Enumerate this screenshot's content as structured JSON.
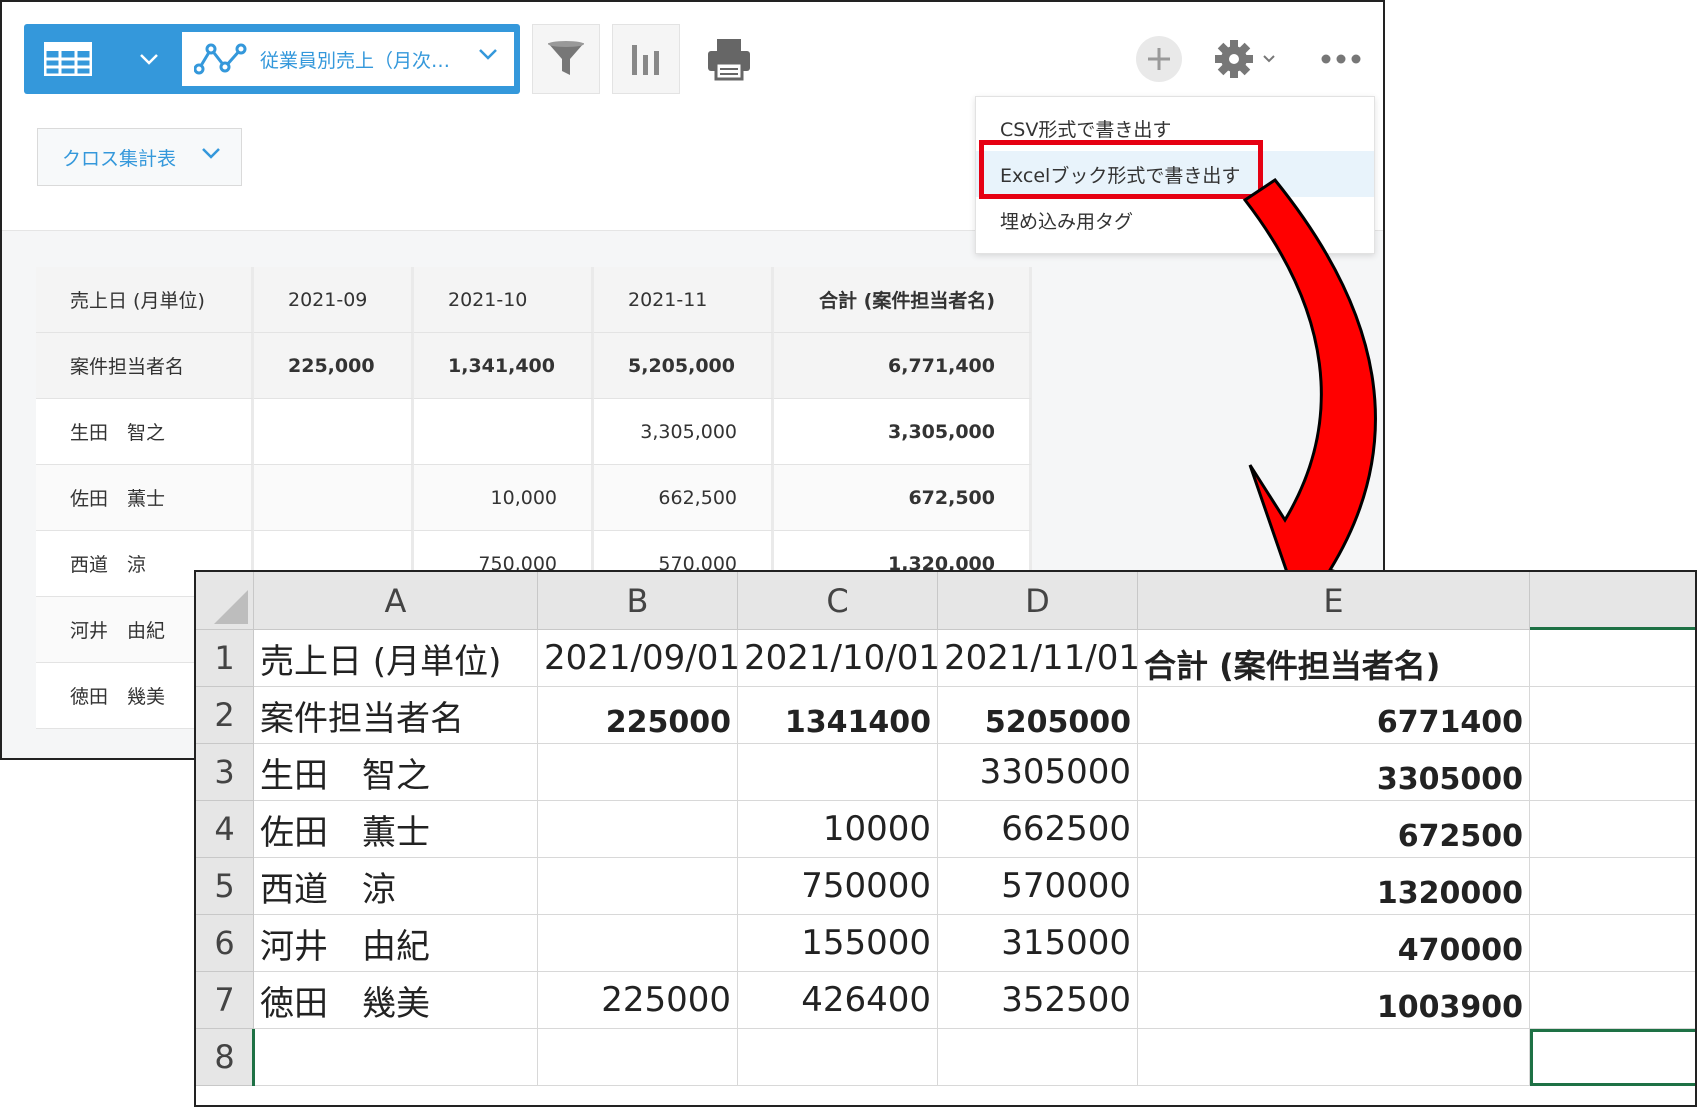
{
  "toolbar": {
    "graph_name": "従業員別売上（月次…",
    "report_type": "クロス集計表"
  },
  "menu": {
    "items": [
      "CSV形式で書き出す",
      "Excelブック形式で書き出す",
      "埋め込み用タグ"
    ]
  },
  "crosstab": {
    "header": [
      "売上日 (月単位)",
      "2021-09",
      "2021-10",
      "2021-11",
      "合計 (案件担当者名)"
    ],
    "total_row": [
      "案件担当者名",
      "225,000",
      "1,341,400",
      "5,205,000",
      "6,771,400"
    ],
    "rows": [
      [
        "生田　智之",
        "",
        "",
        "3,305,000",
        "3,305,000"
      ],
      [
        "佐田　薫士",
        "",
        "10,000",
        "662,500",
        "672,500"
      ],
      [
        "西道　涼",
        "",
        "750,000",
        "570,000",
        "1,320,000"
      ],
      [
        "河井　由紀",
        "",
        "",
        "",
        ""
      ],
      [
        "徳田　幾美",
        "",
        "",
        "",
        ""
      ]
    ]
  },
  "excel": {
    "columns": [
      "A",
      "B",
      "C",
      "D",
      "E"
    ],
    "row_numbers": [
      "1",
      "2",
      "3",
      "4",
      "5",
      "6",
      "7",
      "8"
    ],
    "rows": [
      [
        "売上日 (月単位)",
        "2021/09/01",
        "2021/10/01",
        "2021/11/01",
        "合計 (案件担当者名)"
      ],
      [
        "案件担当者名",
        "225000",
        "1341400",
        "5205000",
        "6771400"
      ],
      [
        "生田　智之",
        "",
        "",
        "3305000",
        "3305000"
      ],
      [
        "佐田　薫士",
        "",
        "10000",
        "662500",
        "672500"
      ],
      [
        "西道　涼",
        "",
        "750000",
        "570000",
        "1320000"
      ],
      [
        "河井　由紀",
        "",
        "155000",
        "315000",
        "470000"
      ],
      [
        "徳田　幾美",
        "225000",
        "426400",
        "352500",
        "1003900"
      ],
      [
        "",
        "",
        "",
        "",
        ""
      ]
    ]
  },
  "colors": {
    "accent_blue": "#3498db",
    "highlight_red": "#e60012",
    "excel_green": "#1e7145"
  }
}
